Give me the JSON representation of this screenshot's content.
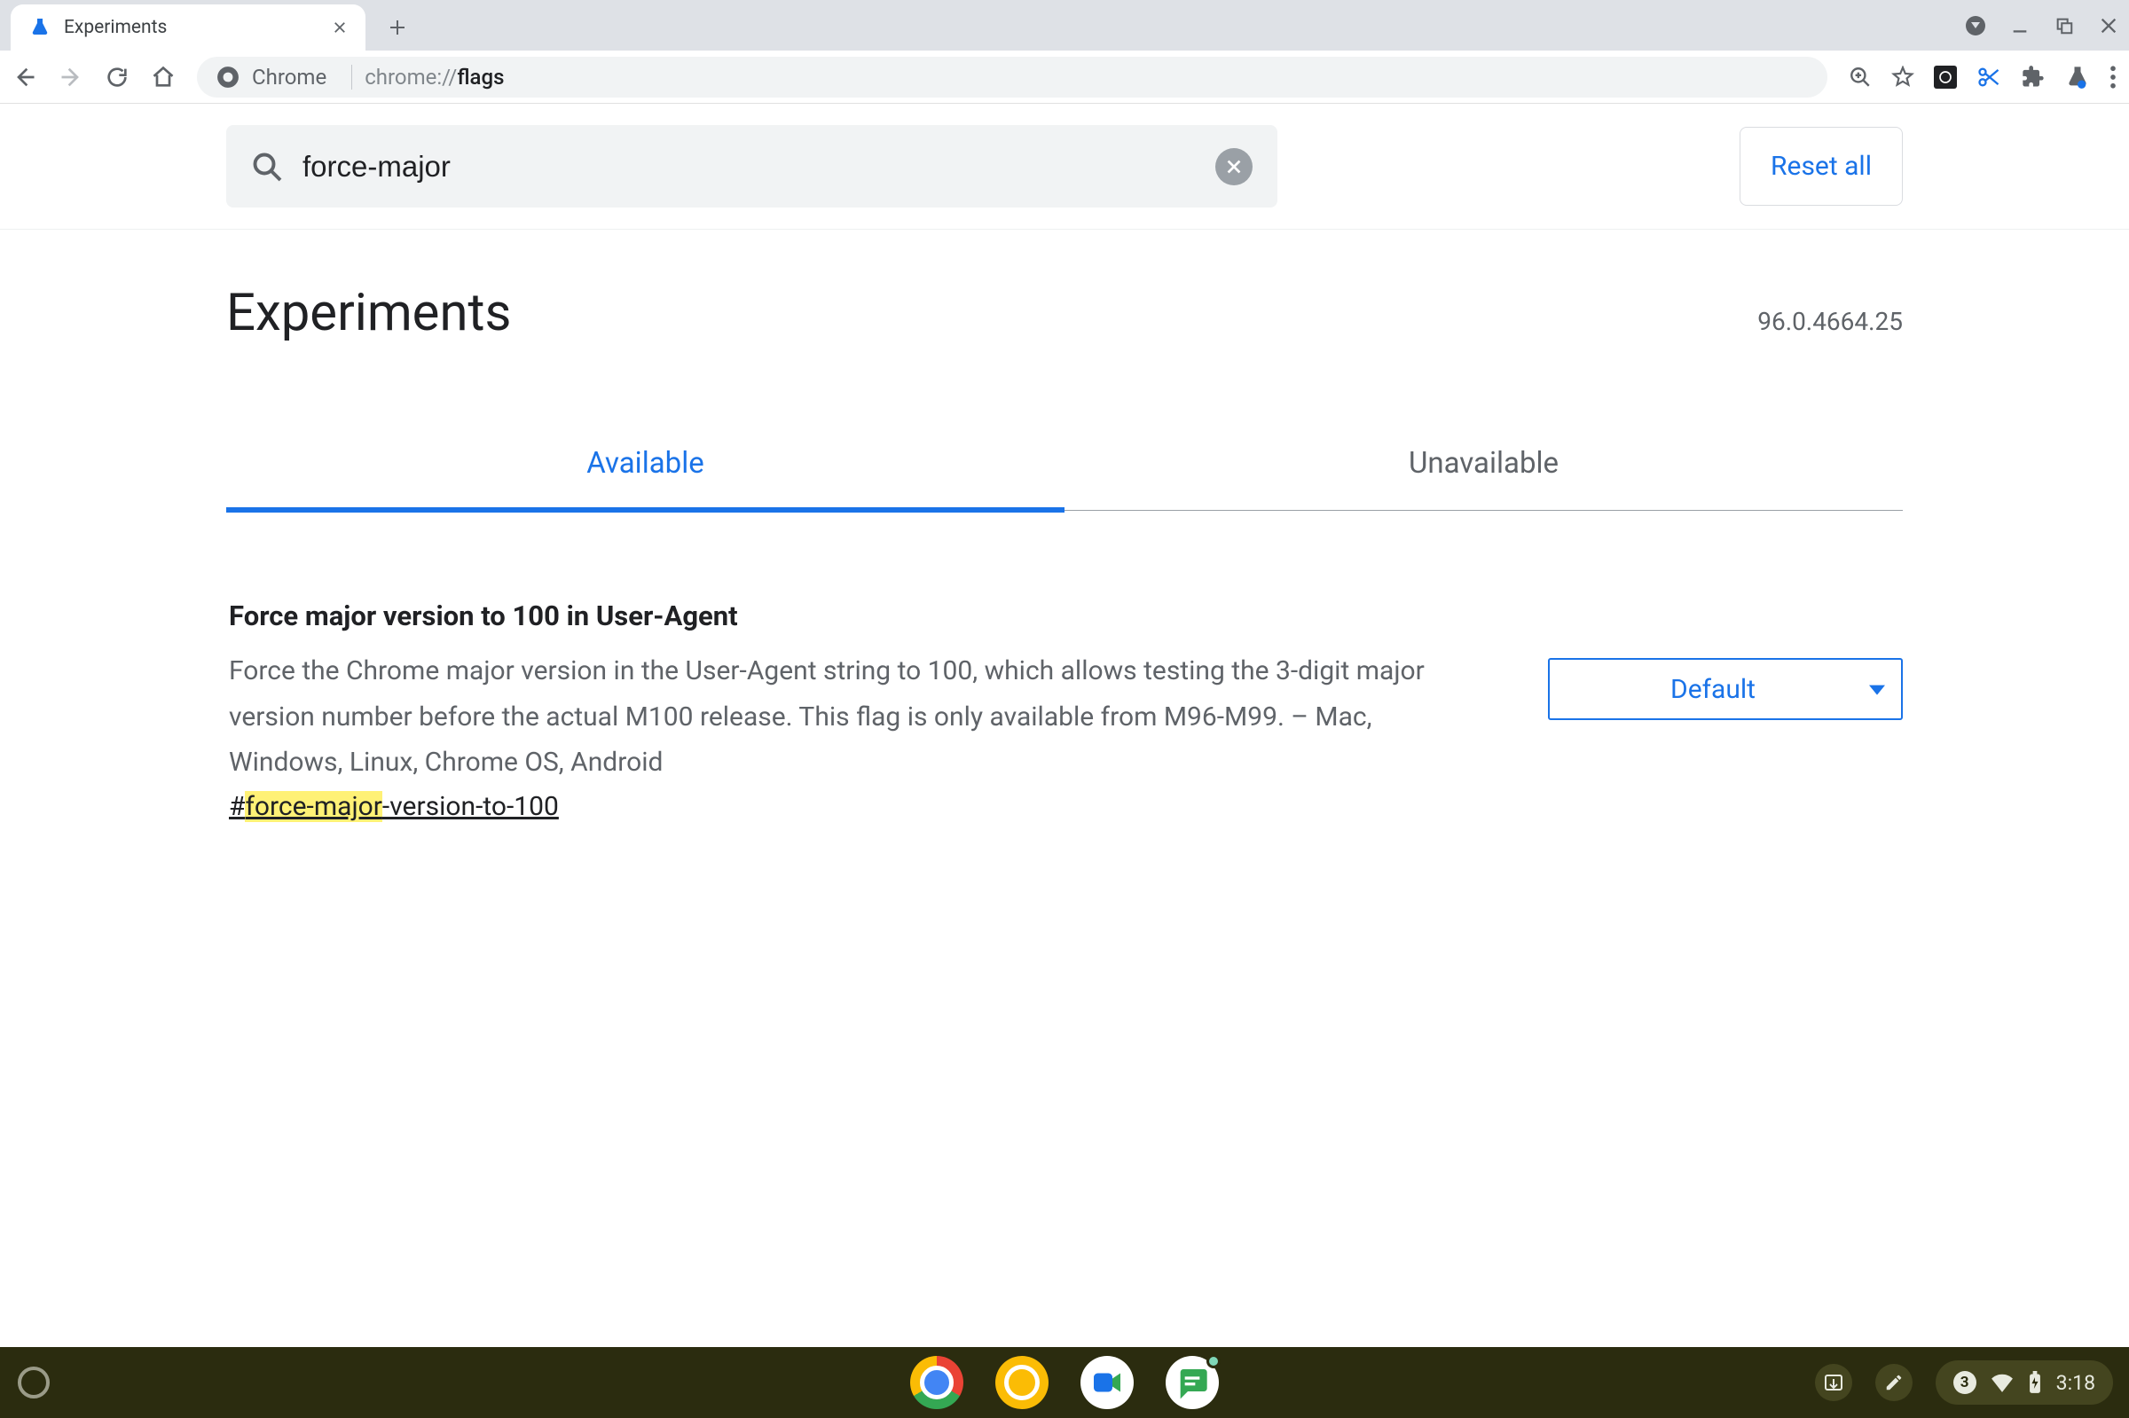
{
  "browser_tab": {
    "title": "Experiments"
  },
  "omnibox": {
    "origin_label": "Chrome",
    "url_prefix": "chrome://",
    "url_path": "flags"
  },
  "search": {
    "value": "force-major"
  },
  "reset_button": "Reset all",
  "page_title": "Experiments",
  "version": "96.0.4664.25",
  "tabs": {
    "available": "Available",
    "unavailable": "Unavailable"
  },
  "flag": {
    "title": "Force major version to 100 in User-Agent",
    "description": "Force the Chrome major version in the User-Agent string to 100, which allows testing the 3-digit major version number before the actual M100 release. This flag is only available from M96-M99. – Mac, Windows, Linux, Chrome OS, Android",
    "hash_prefix": "#",
    "hash_highlight": "force-major",
    "hash_rest": "-version-to-100",
    "dropdown_value": "Default"
  },
  "taskbar": {
    "notification_count": "3",
    "clock": "3:18"
  }
}
